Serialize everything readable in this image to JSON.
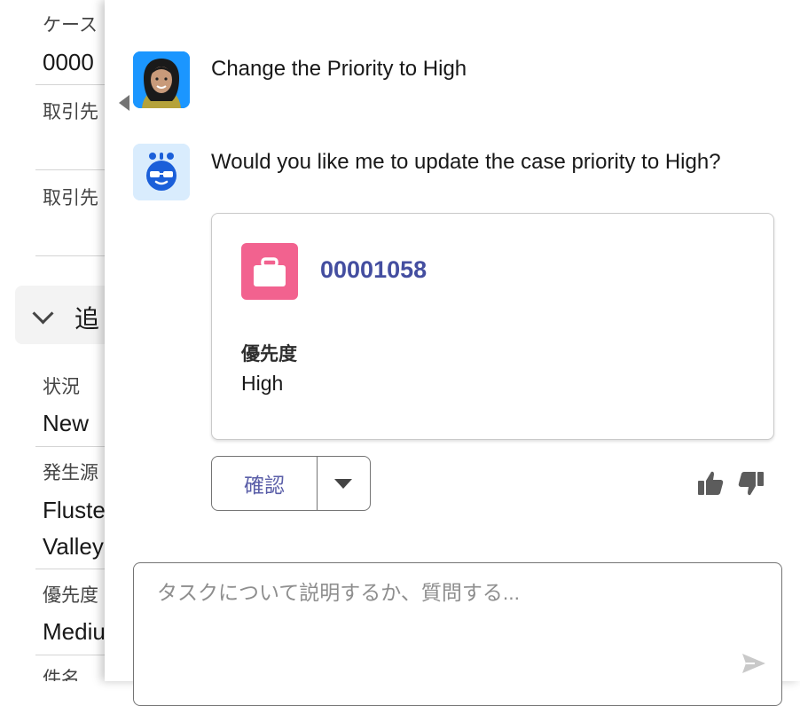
{
  "left_panel": {
    "fields": [
      {
        "label": "ケース",
        "value": "0000"
      },
      {
        "label": "取引先"
      },
      {
        "label": "取引先"
      }
    ],
    "section_title": "追",
    "detail_fields": [
      {
        "label": "状況",
        "value": "New"
      },
      {
        "label": "発生源",
        "value_line1": "Fluste",
        "value_line2": "Valley"
      },
      {
        "label": "優先度",
        "value": "Mediu"
      },
      {
        "label": "件名"
      }
    ]
  },
  "chat": {
    "user_message": "Change the Priority to High",
    "assistant_message": "Would you like me to update the case priority to High?",
    "record_card": {
      "icon": "briefcase-icon",
      "icon_color": "#f2628f",
      "case_number": "00001058",
      "field_label": "優先度",
      "field_value": "High"
    },
    "actions": {
      "confirm_label": "確認",
      "menu_icon": "chevron-down-icon"
    },
    "feedback": {
      "thumbs_up_icon": "thumbs-up-icon",
      "thumbs_down_icon": "thumbs-down-icon"
    },
    "composer": {
      "placeholder": "タスクについて説明するか、質問する...",
      "value": "",
      "send_icon": "send-icon"
    }
  },
  "colors": {
    "case_number": "#444ea0",
    "user_avatar_bg": "#1b96ff",
    "bot_avatar_bg": "#d9ecfd",
    "bot_face": "#1b5fd9"
  }
}
